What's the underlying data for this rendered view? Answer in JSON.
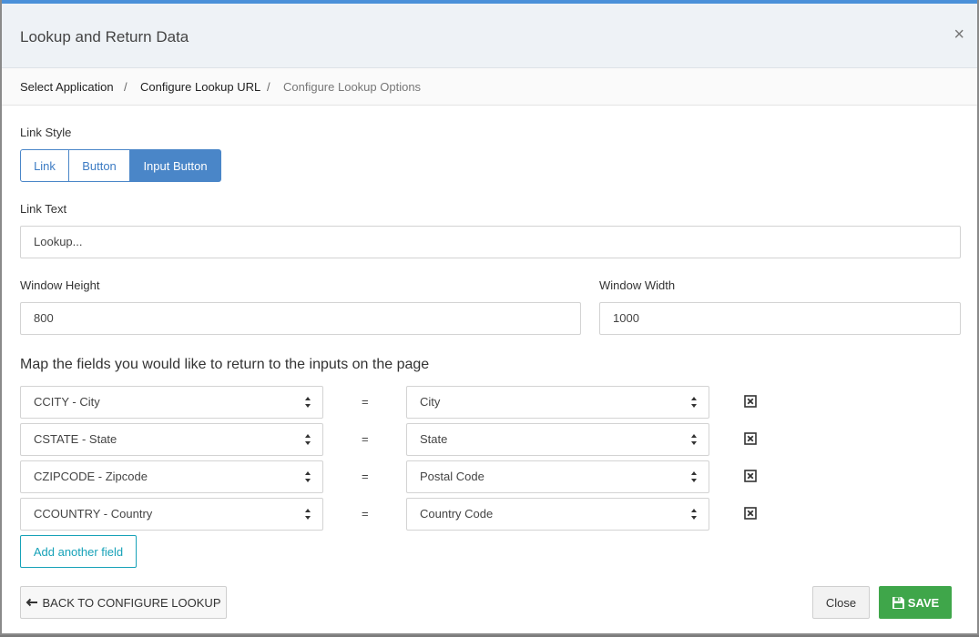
{
  "modal": {
    "title": "Lookup and Return Data",
    "close_symbol": "×"
  },
  "breadcrumb": {
    "items": [
      "Select Application",
      "Configure Lookup URL",
      "Configure Lookup Options"
    ],
    "separator": "/"
  },
  "link_style": {
    "label": "Link Style",
    "options": [
      "Link",
      "Button",
      "Input Button"
    ],
    "selected": "Input Button"
  },
  "link_text": {
    "label": "Link Text",
    "value": "Lookup..."
  },
  "window_height": {
    "label": "Window Height",
    "value": "800"
  },
  "window_width": {
    "label": "Window Width",
    "value": "1000"
  },
  "mapping": {
    "heading": "Map the fields you would like to return to the inputs on the page",
    "equals": "=",
    "rows": [
      {
        "source": "CCITY - City",
        "target": "City"
      },
      {
        "source": "CSTATE - State",
        "target": "State"
      },
      {
        "source": "CZIPCODE - Zipcode",
        "target": "Postal Code"
      },
      {
        "source": "CCOUNTRY - Country",
        "target": "Country Code"
      }
    ],
    "add_label": "Add another field"
  },
  "footer": {
    "back_label": "BACK TO CONFIGURE LOOKUP",
    "close_label": "Close",
    "save_label": "SAVE"
  },
  "icons": {
    "back": "arrow-left-icon",
    "save": "floppy-disk-icon",
    "remove": "close-box-icon",
    "select": "sort-caret-icon"
  },
  "colors": {
    "accent": "#4a86c8",
    "teal": "#17a2b8",
    "save": "#3fa64a"
  }
}
